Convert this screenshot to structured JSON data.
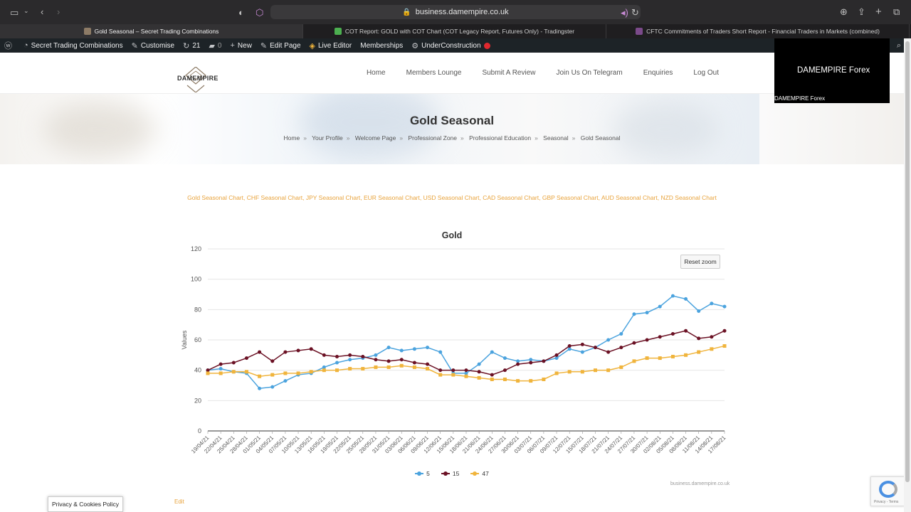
{
  "browser": {
    "url": "business.damempire.co.uk",
    "tabs": [
      {
        "label": "Gold Seasonal – Secret Trading Combinations",
        "active": true,
        "fav_color": "#8d7b66"
      },
      {
        "label": "COT Report: GOLD with COT Chart (COT Legacy Report, Futures Only) - Tradingster",
        "active": false,
        "fav_color": "#4caf50"
      },
      {
        "label": "CFTC Commitments of Traders Short Report - Financial Traders in Markets (combined)",
        "active": false,
        "fav_color": "#7b4a8a"
      }
    ]
  },
  "wpbar": {
    "site": "Secret Trading Combinations",
    "customise": "Customise",
    "updates": "21",
    "comments": "0",
    "new": "New",
    "edit_page": "Edit Page",
    "live_editor": "Live Editor",
    "memberships": "Memberships",
    "under_construction": "UnderConstruction"
  },
  "header": {
    "logo_text": "DAMEMPIRE",
    "nav": [
      "Home",
      "Members Lounge",
      "Submit A Review",
      "Join Us On Telegram",
      "Enquiries",
      "Log Out"
    ]
  },
  "video": {
    "big": "DAMEMPIRE Forex",
    "small": "DAMEMPIRE Forex"
  },
  "page": {
    "title": "Gold Seasonal",
    "breadcrumb": [
      "Home",
      "Your Profile",
      "Welcome Page",
      "Professional Zone",
      "Professional Education",
      "Seasonal",
      "Gold Seasonal"
    ],
    "links": "Gold Seasonal Chart, CHF Seasonal Chart, JPY Seasonal Chart, EUR Seasonal Chart, USD Seasonal Chart, CAD Seasonal Chart, GBP Seasonal Chart, AUD Seasonal Chart, NZD Seasonal Chart",
    "edit": "Edit",
    "privacy": "Privacy & Cookies Policy",
    "credits": "business.damempire.co.uk",
    "reset_zoom": "Reset zoom",
    "recaptcha_text": "Privacy - Terms"
  },
  "chart_data": {
    "type": "line",
    "title": "Gold",
    "ylabel": "Values",
    "ylim": [
      0,
      120
    ],
    "yticks": [
      0,
      20,
      40,
      60,
      80,
      100,
      120
    ],
    "categories": [
      "19/04/21",
      "22/04/21",
      "25/04/21",
      "28/04/21",
      "01/05/21",
      "04/05/21",
      "07/05/21",
      "10/05/21",
      "13/05/21",
      "16/05/21",
      "19/05/21",
      "22/05/21",
      "25/05/21",
      "28/05/21",
      "31/05/21",
      "03/06/21",
      "06/06/21",
      "09/06/21",
      "12/06/21",
      "15/06/21",
      "18/06/21",
      "21/06/21",
      "24/06/21",
      "27/06/21",
      "30/06/21",
      "03/07/21",
      "06/07/21",
      "09/07/21",
      "12/07/21",
      "15/07/21",
      "18/07/21",
      "21/07/21",
      "24/07/21",
      "27/07/21",
      "30/07/21",
      "02/08/21",
      "05/08/21",
      "08/08/21",
      "11/08/21",
      "14/08/21",
      "17/08/21"
    ],
    "series": [
      {
        "name": "5",
        "color": "#4ba3de",
        "values": [
          40,
          41,
          39,
          38,
          28,
          29,
          33,
          37,
          38,
          42,
          45,
          47,
          48,
          50,
          55,
          53,
          54,
          55,
          52,
          38,
          38,
          44,
          52,
          48,
          46,
          47,
          46,
          48,
          54,
          52,
          55,
          60,
          64,
          77,
          78,
          82,
          89,
          87,
          79,
          84,
          82
        ]
      },
      {
        "name": "15",
        "color": "#6b1124",
        "values": [
          40,
          44,
          45,
          48,
          52,
          46,
          52,
          53,
          54,
          50,
          49,
          50,
          49,
          47,
          46,
          47,
          45,
          44,
          40,
          40,
          40,
          39,
          37,
          40,
          44,
          45,
          46,
          50,
          56,
          57,
          55,
          52,
          55,
          58,
          60,
          62,
          64,
          66,
          61,
          62,
          66
        ]
      },
      {
        "name": "47",
        "color": "#f0b43c",
        "values": [
          38,
          38,
          39,
          39,
          36,
          37,
          38,
          38,
          39,
          40,
          40,
          41,
          41,
          42,
          42,
          43,
          42,
          41,
          37,
          37,
          36,
          35,
          34,
          34,
          33,
          33,
          34,
          38,
          39,
          39,
          40,
          40,
          42,
          46,
          48,
          48,
          49,
          50,
          52,
          54,
          56
        ]
      }
    ]
  }
}
